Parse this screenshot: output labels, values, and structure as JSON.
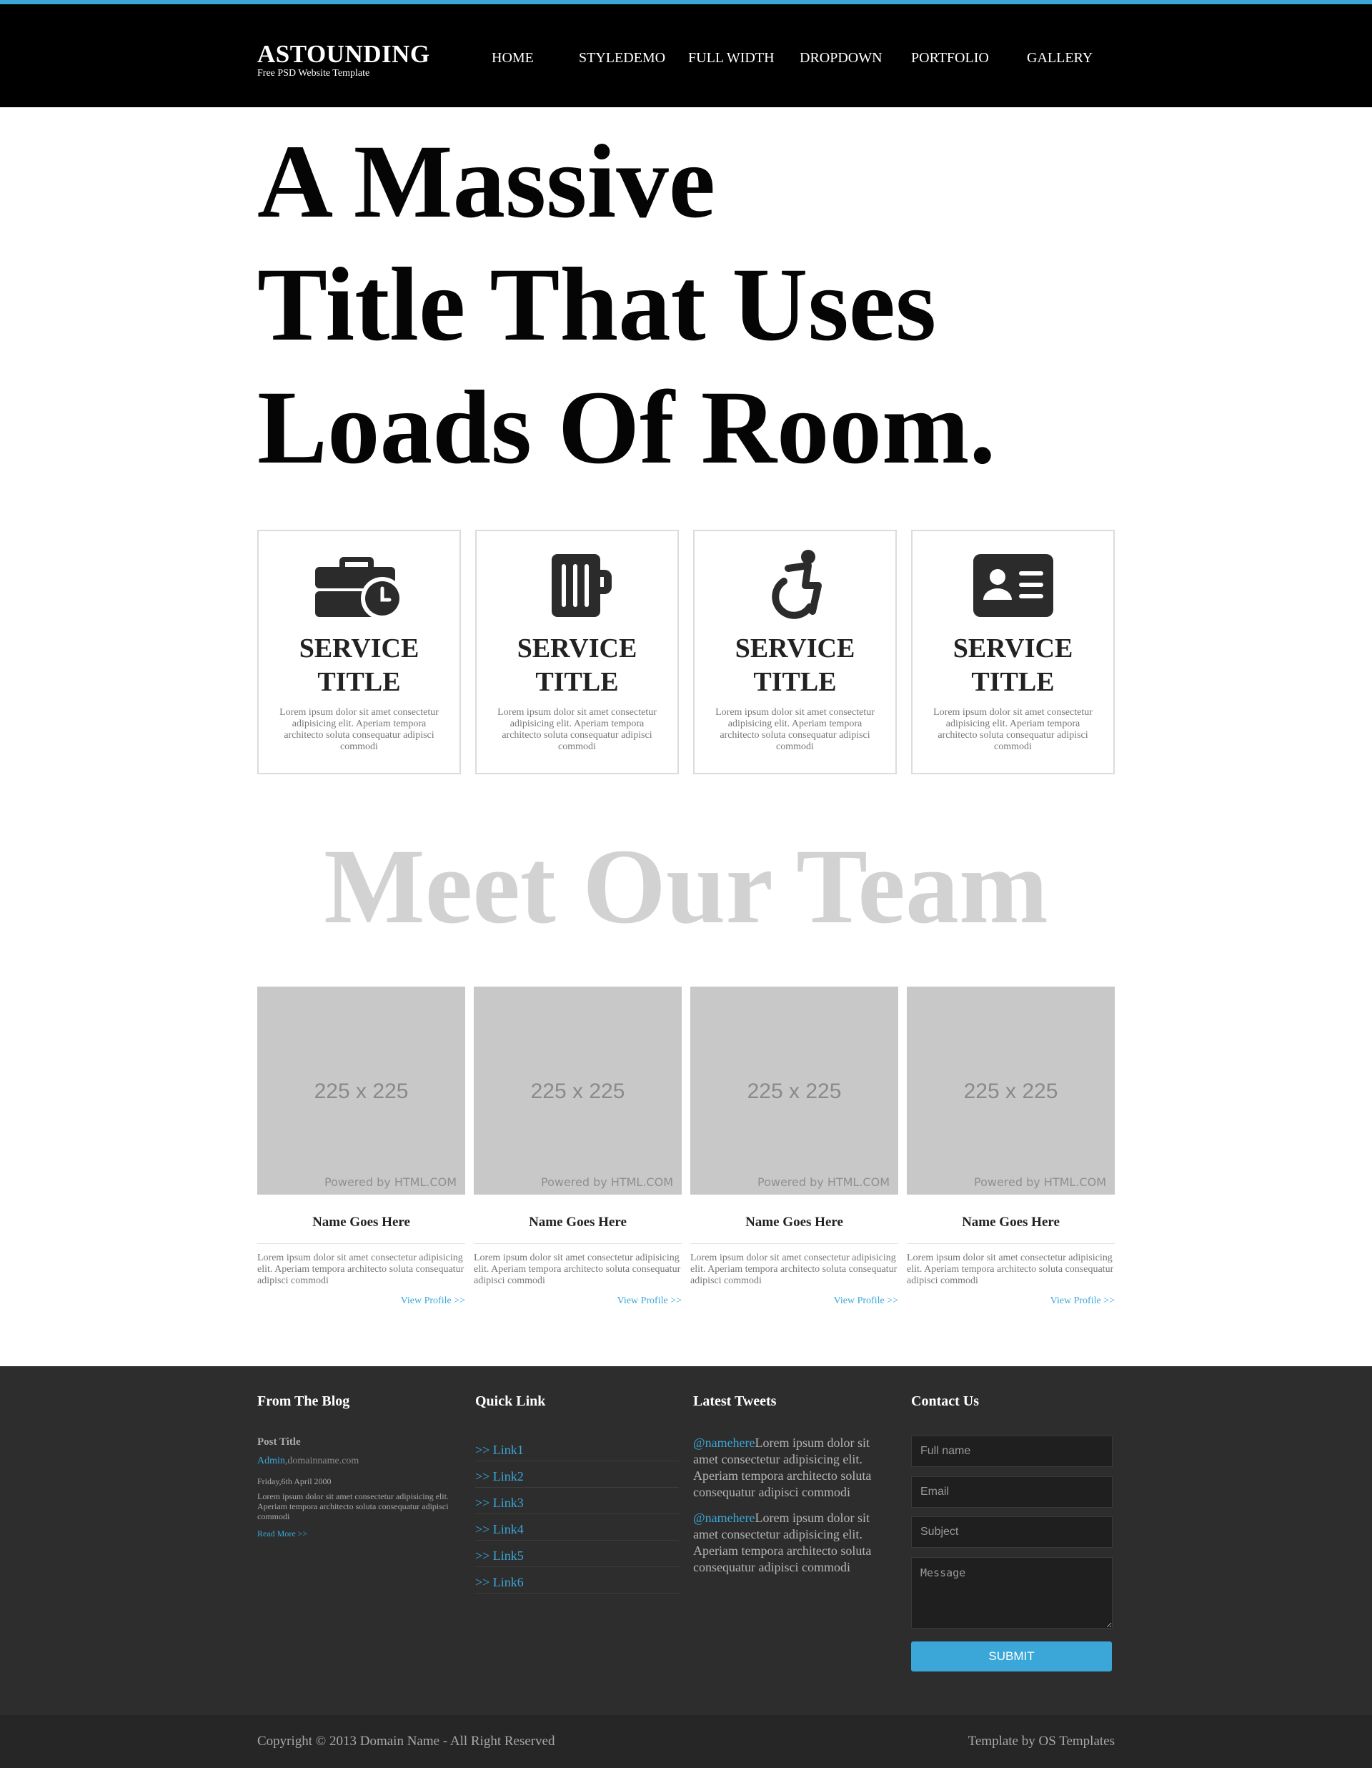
{
  "brand": {
    "title": "ASTOUNDING",
    "subtitle": "Free PSD Website Template"
  },
  "nav": [
    "HOME",
    "STYLEDEMO",
    "FULL WIDTH",
    "DROPDOWN",
    "PORTFOLIO",
    "GALLERY"
  ],
  "hero": {
    "line1": "A Massive",
    "line2": "Title That Uses",
    "line3": "Loads Of Room."
  },
  "services": [
    {
      "icon": "briefcase-clock-icon",
      "title_line1": "SERVICE",
      "title_line2": "TITLE",
      "text": "Lorem ipsum dolor sit amet consectetur adipisicing elit. Aperiam tempora architecto soluta consequatur adipisci commodi"
    },
    {
      "icon": "beer-mug-icon",
      "title_line1": "SERVICE",
      "title_line2": "TITLE",
      "text": "Lorem ipsum dolor sit amet consectetur adipisicing elit. Aperiam tempora architecto soluta consequatur adipisci commodi"
    },
    {
      "icon": "wheelchair-icon",
      "title_line1": "SERVICE",
      "title_line2": "TITLE",
      "text": "Lorem ipsum dolor sit amet consectetur adipisicing elit. Aperiam tempora architecto soluta consequatur adipisci commodi"
    },
    {
      "icon": "id-card-icon",
      "title_line1": "SERVICE",
      "title_line2": "TITLE",
      "text": "Lorem ipsum dolor sit amet consectetur adipisicing elit. Aperiam tempora architecto soluta consequatur adipisci commodi"
    }
  ],
  "team": {
    "heading": "Meet Our Team",
    "members": [
      {
        "photo_label": "225 x 225",
        "photo_credit": "Powered by HTML.COM",
        "name": "Name Goes Here",
        "text": "Lorem ipsum dolor sit amet consectetur adipisicing elit. Aperiam tempora architecto soluta consequatur adipisci commodi",
        "link": "View Profile >>"
      },
      {
        "photo_label": "225 x 225",
        "photo_credit": "Powered by HTML.COM",
        "name": "Name Goes Here",
        "text": "Lorem ipsum dolor sit amet consectetur adipisicing elit. Aperiam tempora architecto soluta consequatur adipisci commodi",
        "link": "View Profile >>"
      },
      {
        "photo_label": "225 x 225",
        "photo_credit": "Powered by HTML.COM",
        "name": "Name Goes Here",
        "text": "Lorem ipsum dolor sit amet consectetur adipisicing elit. Aperiam tempora architecto soluta consequatur adipisci commodi",
        "link": "View Profile >>"
      },
      {
        "photo_label": "225 x 225",
        "photo_credit": "Powered by HTML.COM",
        "name": "Name Goes Here",
        "text": "Lorem ipsum dolor sit amet consectetur adipisicing elit. Aperiam tempora architecto soluta consequatur adipisci commodi",
        "link": "View Profile >>"
      }
    ]
  },
  "footer": {
    "blog": {
      "heading": "From The Blog",
      "post_title": "Post Title",
      "author": "Admin",
      "domain": ",domainname.com",
      "date": "Friday,6th April 2000",
      "text": "Lorem ipsum dolor sit amet consectetur adipisicing elit. Aperiam tempora architecto soluta consequatur adipisci commodi",
      "read_more": "Read More >>"
    },
    "quick_links": {
      "heading": "Quick Link",
      "items": [
        ">> Link1",
        ">> Link2",
        ">> Link3",
        ">> Link4",
        ">> Link5",
        ">> Link6"
      ]
    },
    "tweets": {
      "heading": "Latest Tweets",
      "items": [
        {
          "handle": "@namehere",
          "text": "Lorem ipsum dolor sit amet consectetur adipisicing elit. Aperiam tempora architecto soluta consequatur adipisci commodi"
        },
        {
          "handle": "@namehere",
          "text": "Lorem ipsum dolor sit amet consectetur adipisicing elit. Aperiam tempora architecto soluta consequatur adipisci commodi"
        }
      ]
    },
    "contact": {
      "heading": "Contact Us",
      "fullname_placeholder": "Full name",
      "email_placeholder": "Email",
      "subject_placeholder": "Subject",
      "message_placeholder": "Message",
      "submit_label": "SUBMIT"
    }
  },
  "bottom_bar": {
    "copyright": "Copyright © 2013 Domain Name - All Right Reserved",
    "credit": "Template by OS Templates"
  },
  "colors": {
    "accent": "#3aa7d8",
    "header_bg": "#000000",
    "footer_bg": "#2d2d2d",
    "bottom_bg": "#262626"
  }
}
